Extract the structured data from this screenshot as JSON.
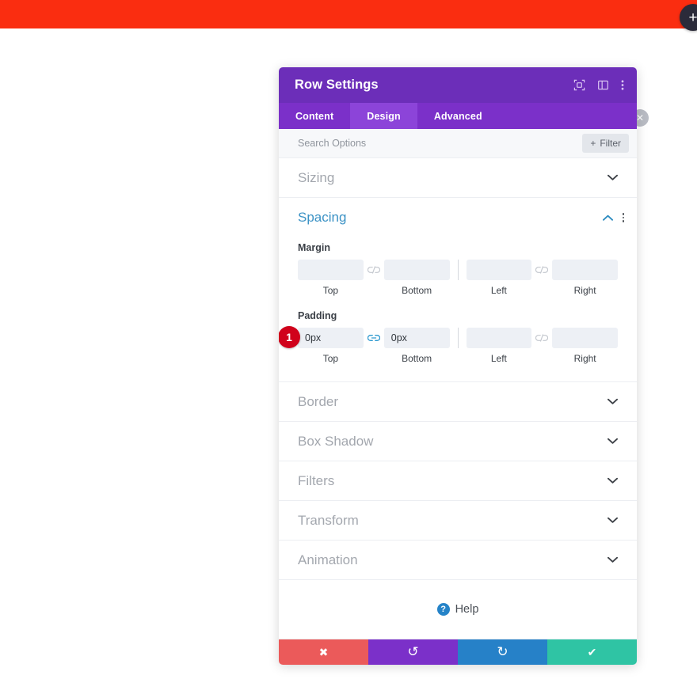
{
  "topbar": {
    "add_button_icon": "plus-icon",
    "color": "#fa2d10"
  },
  "float_close": {
    "icon": "close-circle-icon"
  },
  "modal": {
    "title": "Row Settings",
    "header_color": "#6c2eb9",
    "header_icons": [
      {
        "name": "target-focus-icon",
        "glyph": "⧉"
      },
      {
        "name": "layout-panel-icon",
        "glyph": "▥"
      },
      {
        "name": "more-vertical-icon",
        "glyph": "⋮"
      }
    ],
    "tabs": [
      {
        "label": "Content",
        "active": false
      },
      {
        "label": "Design",
        "active": true
      },
      {
        "label": "Advanced",
        "active": false
      }
    ],
    "search": {
      "placeholder": "Search Options",
      "value": ""
    },
    "filter_button": {
      "label": "Filter",
      "icon": "plus-icon"
    },
    "sections": [
      {
        "label": "Sizing",
        "state": "collapsed"
      },
      {
        "label": "Spacing",
        "state": "expanded"
      },
      {
        "label": "Border",
        "state": "collapsed"
      },
      {
        "label": "Box Shadow",
        "state": "collapsed"
      },
      {
        "label": "Filters",
        "state": "collapsed"
      },
      {
        "label": "Transform",
        "state": "collapsed"
      },
      {
        "label": "Animation",
        "state": "collapsed"
      }
    ],
    "spacing": {
      "title": "Spacing",
      "margin": {
        "label": "Margin",
        "top": {
          "label": "Top",
          "value": "",
          "placeholder": ""
        },
        "bottom": {
          "label": "Bottom",
          "value": "",
          "placeholder": ""
        },
        "left": {
          "label": "Left",
          "value": "",
          "placeholder": ""
        },
        "right": {
          "label": "Right",
          "value": "",
          "placeholder": ""
        },
        "link_top_bottom": "unlinked",
        "link_left_right": "unlinked"
      },
      "padding": {
        "label": "Padding",
        "badge": "1",
        "top": {
          "label": "Top",
          "value": "0px",
          "placeholder": ""
        },
        "bottom": {
          "label": "Bottom",
          "value": "0px",
          "placeholder": ""
        },
        "left": {
          "label": "Left",
          "value": "",
          "placeholder": ""
        },
        "right": {
          "label": "Right",
          "value": "",
          "placeholder": ""
        },
        "link_top_bottom": "linked",
        "link_left_right": "unlinked"
      }
    },
    "help": {
      "label": "Help",
      "icon": "question-circle-icon"
    },
    "footer": [
      {
        "name": "cancel",
        "icon": "x-icon",
        "glyph": "✖",
        "color": "#eb5a5a"
      },
      {
        "name": "undo",
        "icon": "undo-icon",
        "glyph": "↺",
        "color": "#7b30c9"
      },
      {
        "name": "redo",
        "icon": "redo-icon",
        "glyph": "↻",
        "color": "#2681c8"
      },
      {
        "name": "save",
        "icon": "checkmark-icon",
        "glyph": "✔",
        "color": "#2fc4a4"
      }
    ]
  }
}
